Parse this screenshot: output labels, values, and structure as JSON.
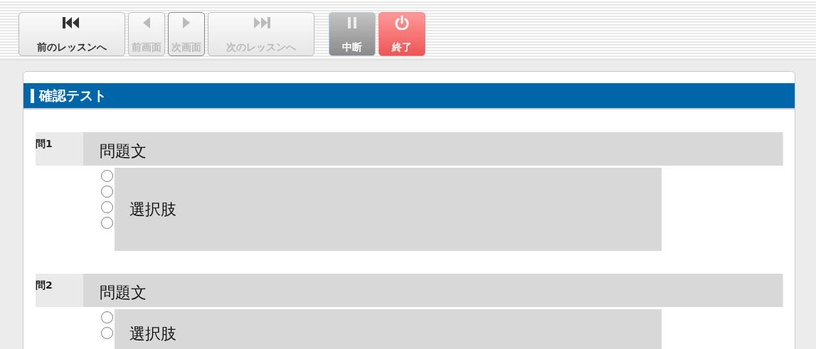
{
  "toolbar": [
    {
      "kind": "prev-lesson",
      "label": "前のレッスンへ",
      "disabled": false
    },
    {
      "kind": "prev",
      "label": "前画面",
      "disabled": true
    },
    {
      "kind": "next",
      "label": "次画面",
      "disabled": true
    },
    {
      "kind": "next-lesson",
      "label": "次のレッスンへ",
      "disabled": true
    },
    {
      "kind": "pause",
      "label": "中断",
      "disabled": true
    },
    {
      "kind": "exit",
      "label": "終了",
      "disabled": false
    }
  ],
  "section": {
    "title": "確認テスト"
  },
  "questions": [
    {
      "number": "問1",
      "text": "問題文",
      "choice_text": "選択肢",
      "choices": [
        {
          "selected": false
        },
        {
          "selected": false
        },
        {
          "selected": false
        },
        {
          "selected": false
        }
      ]
    },
    {
      "number": "問2",
      "text": "問題文",
      "choice_text": "選択肢",
      "choices": [
        {
          "selected": false
        },
        {
          "selected": false
        }
      ]
    }
  ]
}
